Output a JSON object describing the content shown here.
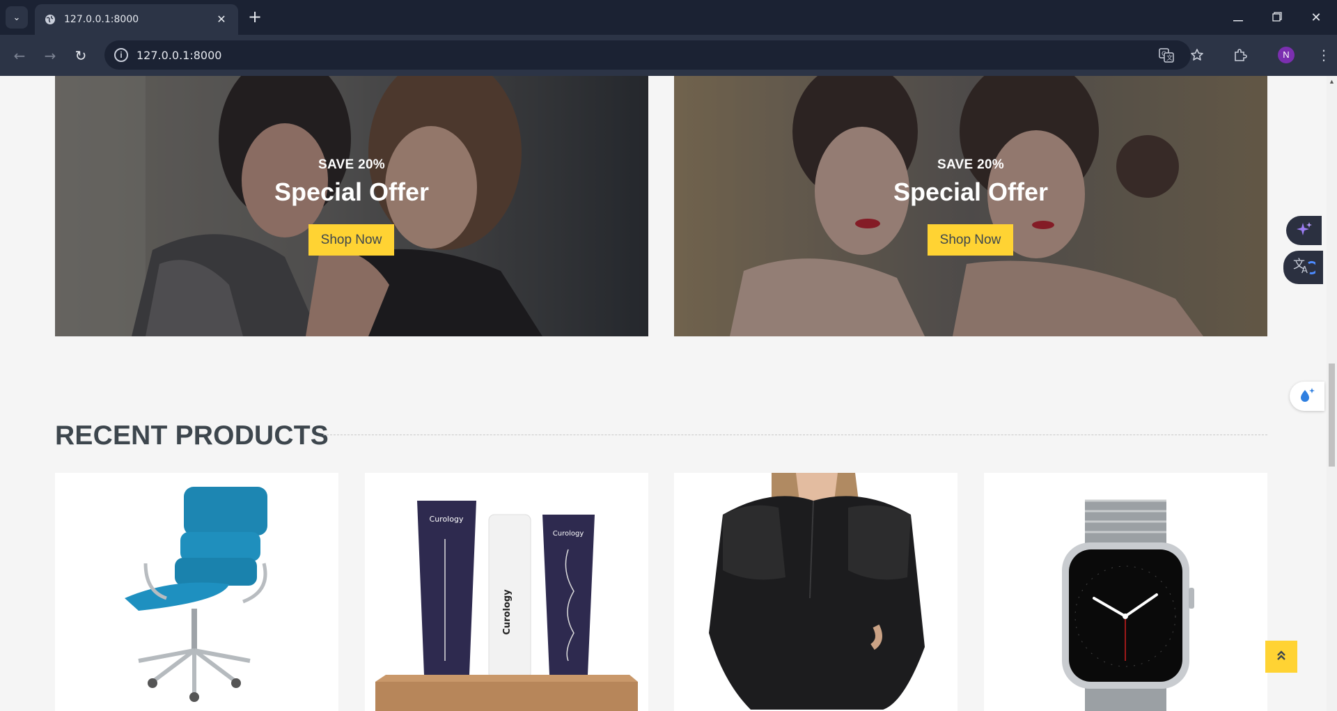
{
  "browser": {
    "tab_title": "127.0.0.1:8000",
    "url": "127.0.0.1:8000",
    "profile_initial": "N",
    "icons": {
      "tab_search": "chevron-down-icon",
      "tab_favicon": "globe-icon",
      "tab_close": "close-icon",
      "new_tab": "plus-icon",
      "minimize": "minimize-icon",
      "restore": "restore-icon",
      "close_window": "close-icon",
      "back": "arrow-left-icon",
      "forward": "arrow-right-icon",
      "reload": "reload-icon",
      "site_info": "info-icon",
      "translate": "translate-icon",
      "bookmark": "star-icon",
      "extensions": "puzzle-icon",
      "menu": "kebab-menu-icon"
    },
    "glyphs": {
      "tab_search": "⌄",
      "tab_close": "✕",
      "new_tab": "+",
      "minimize": "—",
      "restore": "❐",
      "close_window": "✕",
      "back": "←",
      "forward": "→",
      "reload": "↻",
      "site_info": "i",
      "menu": "⋮"
    }
  },
  "offers": [
    {
      "discount": "SAVE 20%",
      "title": "Special Offer",
      "button": "Shop Now"
    },
    {
      "discount": "SAVE 20%",
      "title": "Special Offer",
      "button": "Shop Now"
    }
  ],
  "recent_products": {
    "heading": "RECENT PRODUCTS",
    "items": [
      {
        "image": "blue-office-chair"
      },
      {
        "image": "curology-skincare-set",
        "brand_label": "Curology"
      },
      {
        "image": "black-lace-blouse"
      },
      {
        "image": "silver-smartwatch"
      }
    ]
  },
  "widgets": {
    "back_to_top": "double-chevron-up-icon",
    "ai_assistant": "sparkle-icon",
    "translate": "translate-icon",
    "eyedropper": "droplet-sparkle-icon"
  },
  "colors": {
    "accent": "#ffd333",
    "heading": "#3d464d",
    "chrome_dark": "#1b2233",
    "chrome": "#2c3446",
    "page_bg": "#f5f5f5"
  }
}
